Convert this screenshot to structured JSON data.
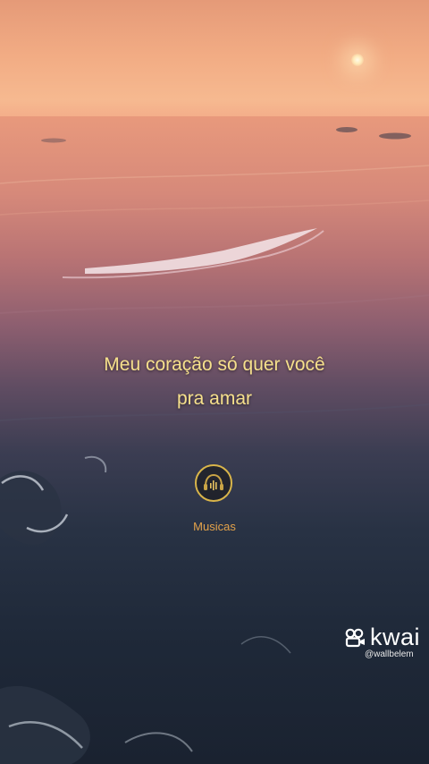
{
  "lyrics": {
    "line1": "Meu coração só quer você",
    "line2": "pra amar"
  },
  "channel_logo": {
    "sublabel": "Musicas",
    "icon": "headphones-equalizer-icon",
    "ring_color": "#d9b54a"
  },
  "watermark": {
    "brand": "kwai",
    "handle": "@wallbelem",
    "icon": "kwai-logo-icon"
  },
  "colors": {
    "caption": "#f6e08c",
    "sublabel": "#e3a24a"
  }
}
